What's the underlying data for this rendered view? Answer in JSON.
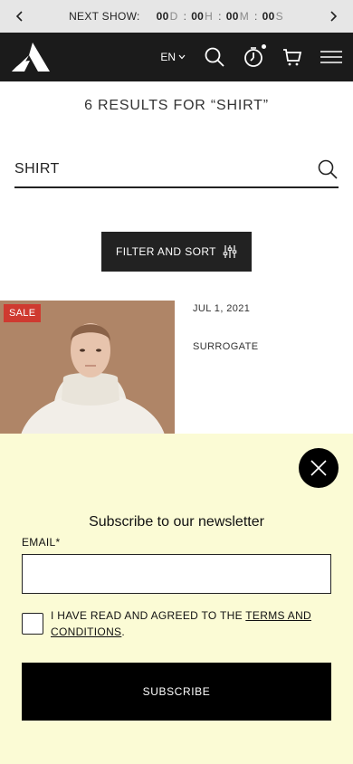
{
  "announcement": {
    "label": "NEXT SHOW:",
    "days": "00",
    "days_unit": "D",
    "hours": "00",
    "hours_unit": "H",
    "minutes": "00",
    "minutes_unit": "M",
    "seconds": "00",
    "seconds_unit": "S",
    "separator": ":"
  },
  "header": {
    "language": "EN",
    "icons": [
      "logo-icon",
      "search-icon",
      "live-icon",
      "cart-icon",
      "menu-icon"
    ]
  },
  "results": {
    "title": "6 RESULTS FOR “SHIRT”",
    "search_value": "SHIRT"
  },
  "filter": {
    "label": "FILTER AND SORT"
  },
  "product": {
    "badge": "SALE",
    "date": "JUL 1, 2021",
    "name": "SURROGATE"
  },
  "newsletter": {
    "title": "Subscribe to our newsletter",
    "email_label": "EMAIL*",
    "agree_prefix": "I HAVE READ AND AGREED TO THE ",
    "terms_link": "TERMS AND CONDITIONS",
    "agree_suffix": ".",
    "subscribe_label": "SUBSCRIBE"
  },
  "colors": {
    "header_bg": "#1b1b1b",
    "topbar_bg": "#e6e6e6",
    "sale": "#cf3a30",
    "newsletter_bg": "#fbfbd5"
  }
}
